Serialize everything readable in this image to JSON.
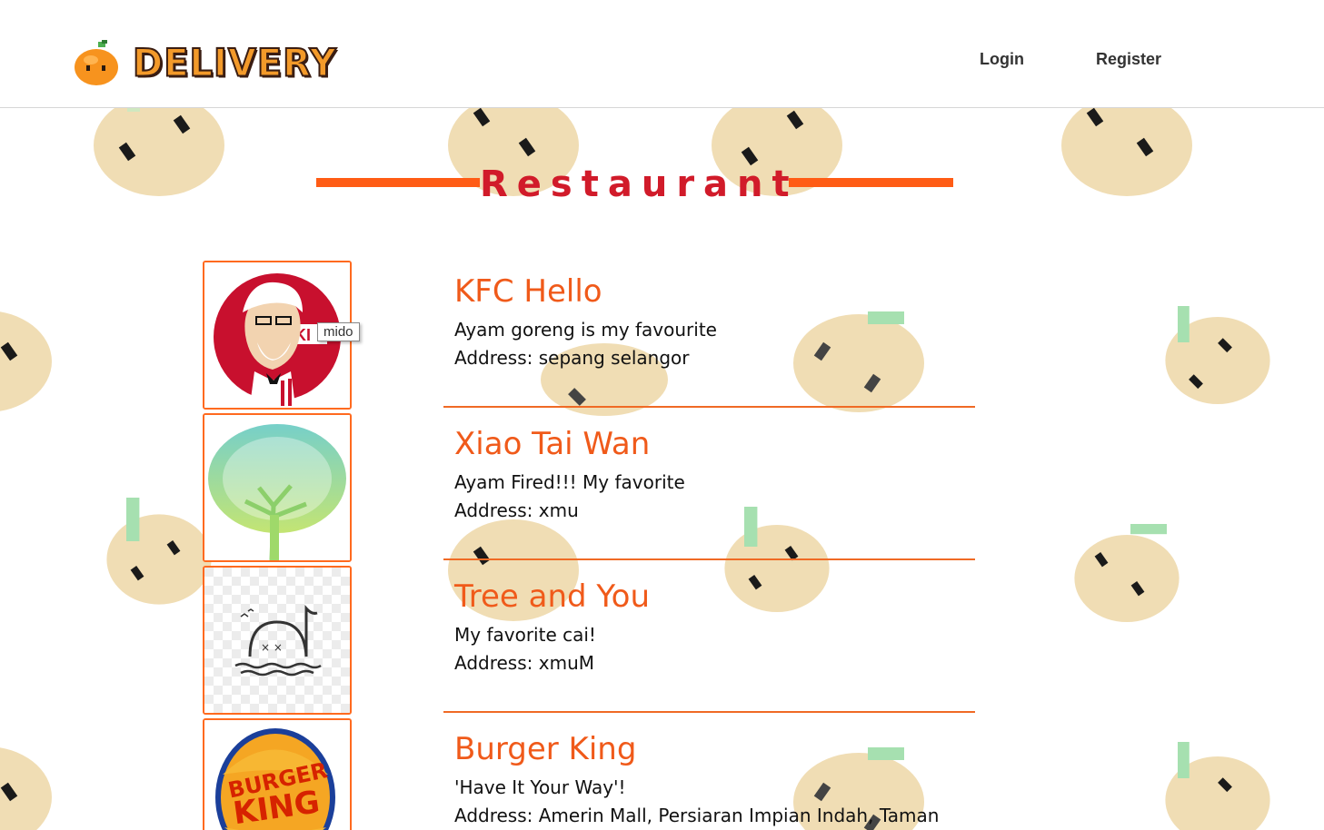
{
  "header": {
    "logo_text": "DELIVERY",
    "nav": {
      "login": "Login",
      "register": "Register"
    }
  },
  "section": {
    "title": "Restaurant"
  },
  "restaurants": [
    {
      "name": "KFC Hello",
      "description": "Ayam goreng is my favourite",
      "address": "Address: sepang selangor",
      "image": "kfc-logo"
    },
    {
      "name": "Xiao Tai Wan",
      "description": "Ayam Fired!!! My favorite",
      "address": "Address: xmu",
      "image": "tree-logo"
    },
    {
      "name": "Tree and You",
      "description": "My favorite cai!",
      "address": "Address: xmuM",
      "image": "sinking-face-logo"
    },
    {
      "name": "Burger King",
      "description": "'Have It Your Way'!",
      "address": "Address: Amerin Mall, Persiaran Impian Indah, Taman",
      "image": "burger-king-logo"
    }
  ],
  "tooltip": {
    "text": "mido"
  },
  "colors": {
    "accent": "#ff5c15",
    "title": "#d11b2a",
    "name": "#f05a1a",
    "pattern_fruit": "#f0ddb4"
  }
}
